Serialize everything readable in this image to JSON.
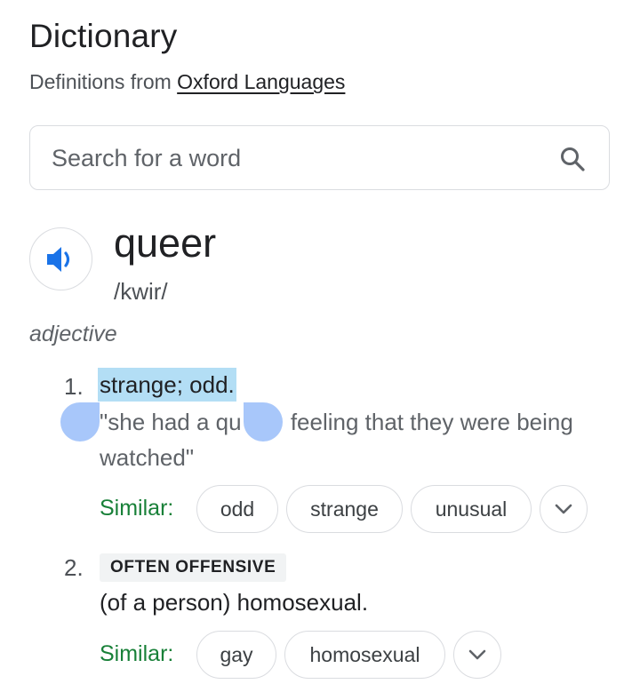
{
  "header": {
    "title": "Dictionary",
    "source_prefix": "Definitions from",
    "source_link": "Oxford Languages"
  },
  "search": {
    "placeholder": "Search for a word",
    "value": ""
  },
  "entry": {
    "word": "queer",
    "phonetic": "/kwir/",
    "part_of_speech": "adjective",
    "senses": [
      {
        "number": "1.",
        "definition": "strange; odd.",
        "example_start": "\"she had a qu",
        "example_end": " feeling that they were being watched\"",
        "similar_label": "Similar:",
        "similar": [
          "odd",
          "strange",
          "unusual"
        ]
      },
      {
        "number": "2.",
        "label": "OFTEN OFFENSIVE",
        "definition": "(of a person) homosexual.",
        "similar_label": "Similar:",
        "similar": [
          "gay",
          "homosexual"
        ]
      }
    ]
  },
  "colors": {
    "highlight": "#b3def5",
    "selection_handle": "#a8c7fa",
    "similar_green": "#188038",
    "speaker_blue": "#1a73e8"
  }
}
